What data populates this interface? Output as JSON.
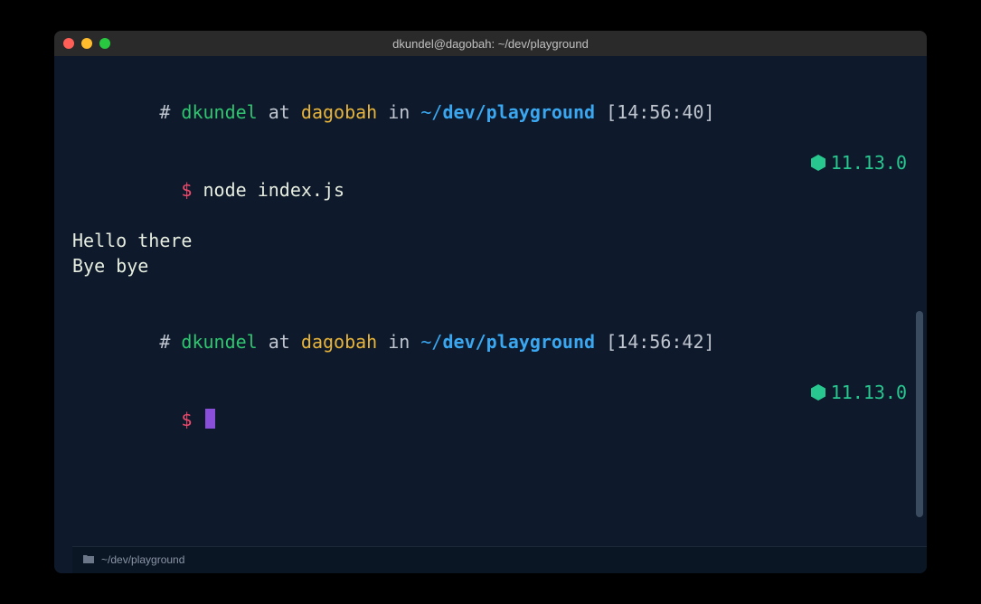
{
  "titlebar": {
    "title": "dkundel@dagobah: ~/dev/playground"
  },
  "blocks": [
    {
      "context": {
        "hash": "#",
        "user": "dkundel",
        "at": "at",
        "host": "dagobah",
        "in": "in",
        "path_prefix": "~/",
        "path_bold": "dev/playground",
        "time": "[14:56:40]"
      },
      "prompt": {
        "symbol": "$",
        "command": "node index.js",
        "version": "11.13.0"
      },
      "output": [
        "Hello there",
        "Bye bye"
      ]
    },
    {
      "context": {
        "hash": "#",
        "user": "dkundel",
        "at": "at",
        "host": "dagobah",
        "in": "in",
        "path_prefix": "~/",
        "path_bold": "dev/playground",
        "time": "[14:56:42]"
      },
      "prompt": {
        "symbol": "$",
        "command": "",
        "version": "11.13.0"
      },
      "output": []
    }
  ],
  "tabbar": {
    "label": "~/dev/playground"
  },
  "colors": {
    "badge_hex": "#28c78f"
  }
}
